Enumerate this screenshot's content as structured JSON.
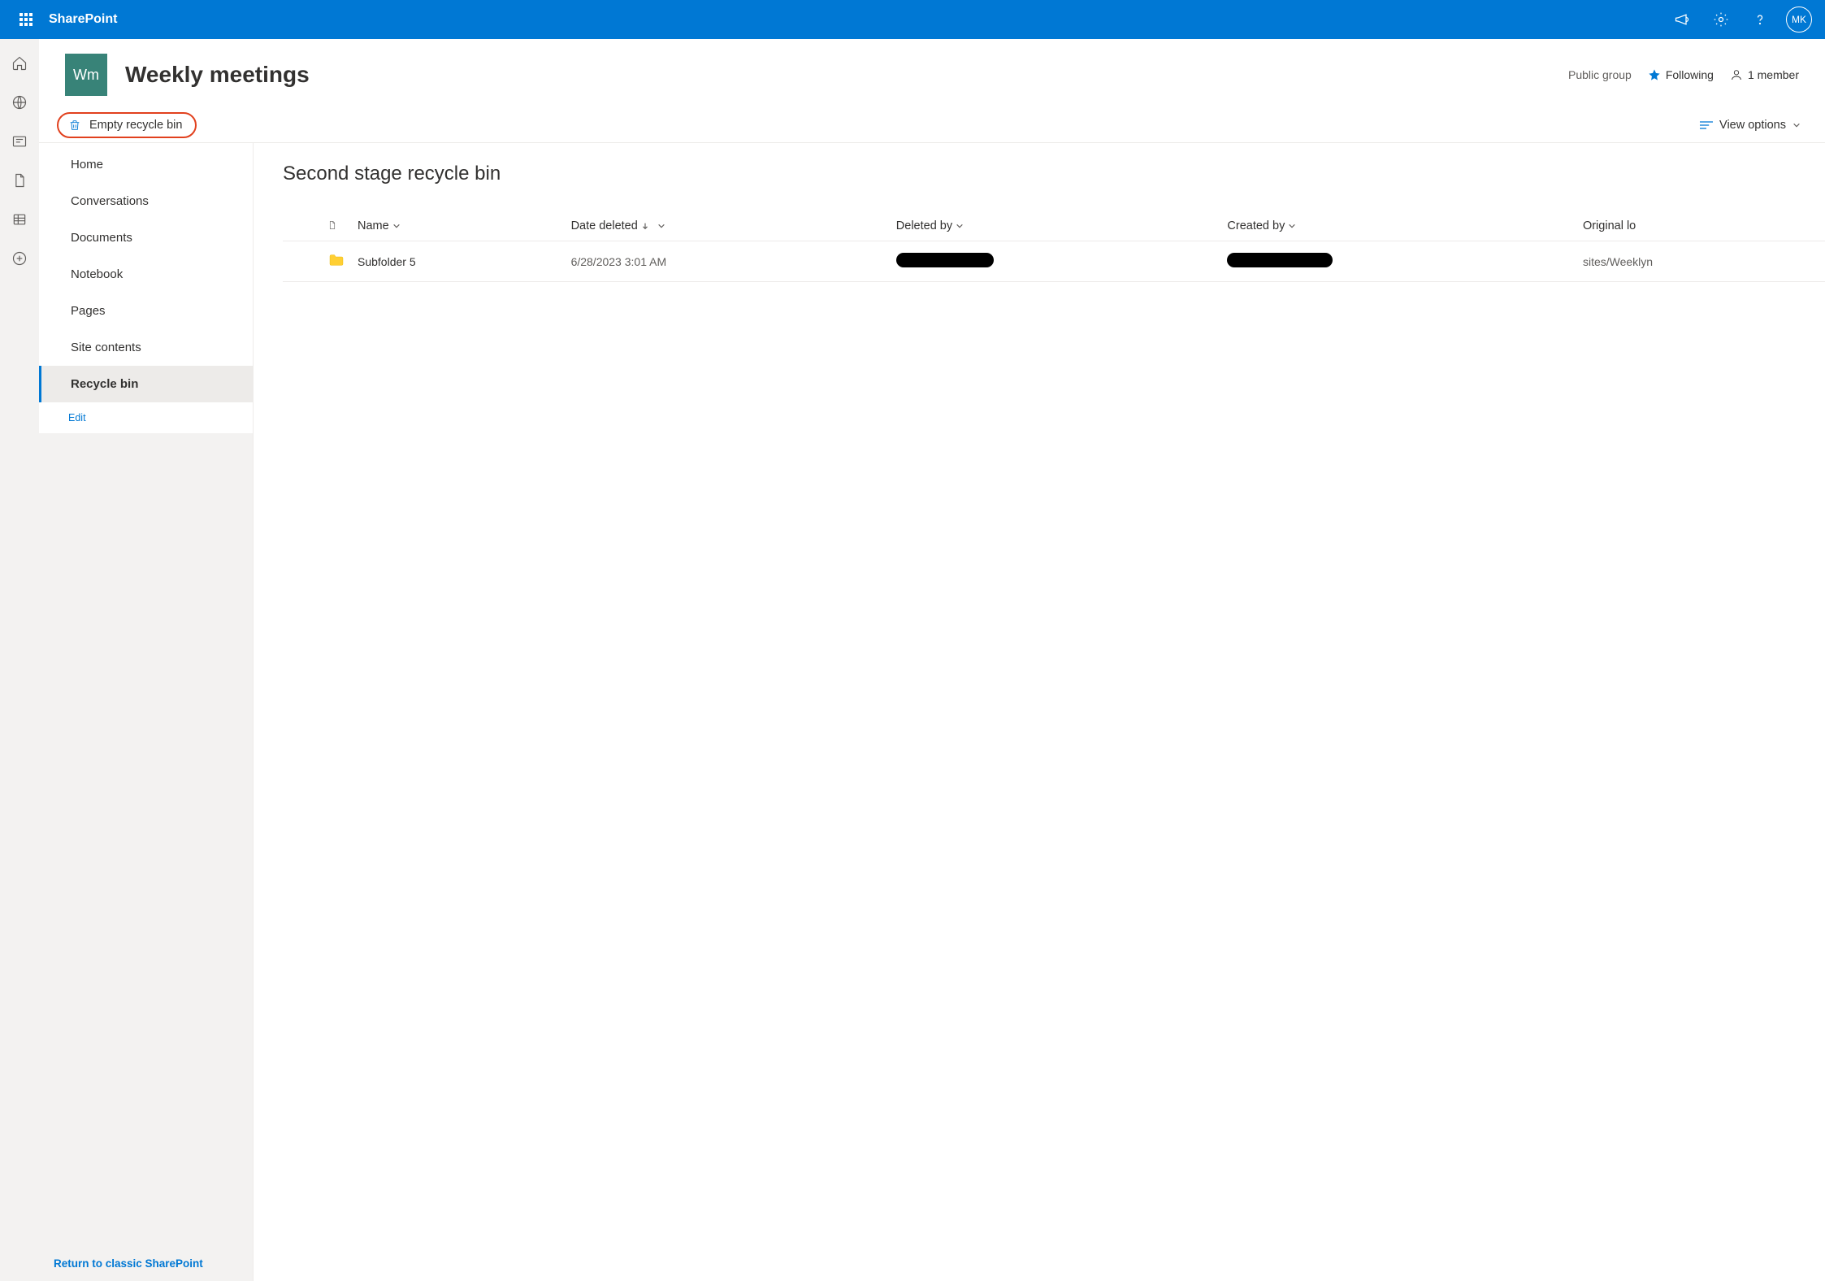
{
  "suite": {
    "title": "SharePoint",
    "avatar": "MK"
  },
  "site": {
    "logo_text": "Wm",
    "title": "Weekly meetings",
    "visibility": "Public group",
    "follow_label": "Following",
    "members_label": "1 member"
  },
  "command_bar": {
    "empty_label": "Empty recycle bin",
    "view_options_label": "View options"
  },
  "left_nav": {
    "items": [
      "Home",
      "Conversations",
      "Documents",
      "Notebook",
      "Pages",
      "Site contents",
      "Recycle bin"
    ],
    "selected_index": 6,
    "edit_label": "Edit",
    "footer_label": "Return to classic SharePoint"
  },
  "panel": {
    "title": "Second stage recycle bin",
    "columns": {
      "name": "Name",
      "date_deleted": "Date deleted",
      "deleted_by": "Deleted by",
      "created_by": "Created by",
      "original_location": "Original lo"
    },
    "rows": [
      {
        "name": "Subfolder 5",
        "date_deleted": "6/28/2023 3:01 AM",
        "deleted_by": "[redacted]",
        "created_by": "[redacted]",
        "original_location": "sites/Weeklyn"
      }
    ]
  }
}
